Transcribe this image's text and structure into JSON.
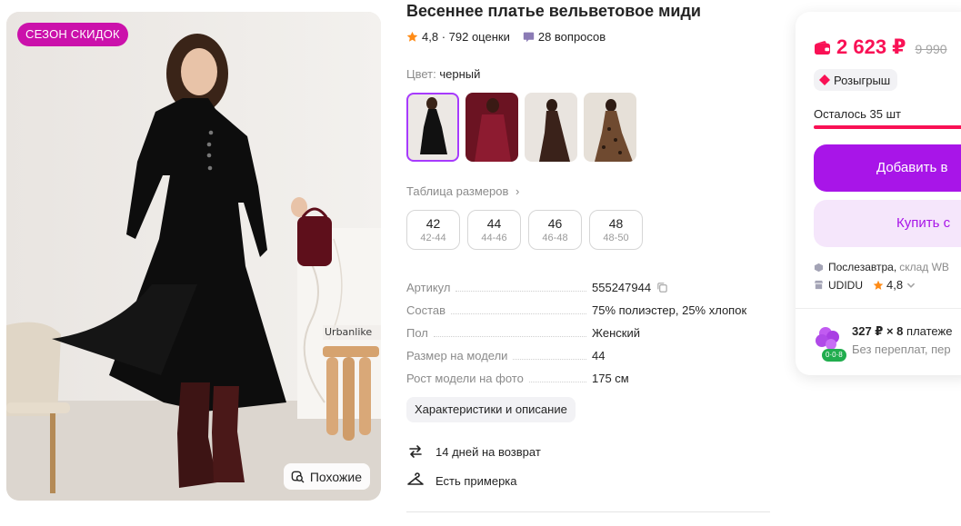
{
  "photo": {
    "badge": "СЕЗОН СКИДОК",
    "watermark": "Urbanlike",
    "similar_label": "Похожие"
  },
  "product": {
    "title": "Весеннее платье вельветовое миди",
    "rating": "4,8",
    "reviews": "792 оценки",
    "separator": " · ",
    "questions": "28 вопросов",
    "color_label": "Цвет:",
    "color_value": "черный",
    "size_table_link": "Таблица размеров",
    "sizes": [
      {
        "ru": "42",
        "alt": "42-44"
      },
      {
        "ru": "44",
        "alt": "44-46"
      },
      {
        "ru": "46",
        "alt": "46-48"
      },
      {
        "ru": "48",
        "alt": "48-50"
      }
    ],
    "specs": [
      {
        "key": "Артикул",
        "value": "555247944"
      },
      {
        "key": "Состав",
        "value": "75% полиэстер, 25% хлопок"
      },
      {
        "key": "Пол",
        "value": "Женский"
      },
      {
        "key": "Размер на модели",
        "value": "44"
      },
      {
        "key": "Рост модели на фото",
        "value": "175 см"
      }
    ],
    "description_button": "Характеристики и описание",
    "services": [
      {
        "label": "14 дней на возврат",
        "icon": "return-arrows-icon"
      },
      {
        "label": "Есть примерка",
        "icon": "hanger-icon"
      }
    ]
  },
  "buy_card": {
    "price": "2 623 ₽",
    "old_price": "9 990",
    "raffle": "Розыгрыш",
    "stock_label": "Осталось 35 шт",
    "stock_fraction": 0.98,
    "add_to_cart": "Добавить в",
    "buy_now": "Купить с",
    "delivery": "Послезавтра,",
    "warehouse": "склад WB",
    "seller": "UDIDU",
    "seller_rating": "4,8",
    "installment_main": "327 ₽ × 8",
    "installment_suffix": "платеже",
    "installment_note": "Без переплат, пер",
    "installment_badge": "0·0·8"
  },
  "colors": {
    "accent": "#a815e8",
    "price_red": "#f91155",
    "badge_magenta": "#cb11ab",
    "star": "#ff8b16",
    "green": "#21ad4e"
  }
}
